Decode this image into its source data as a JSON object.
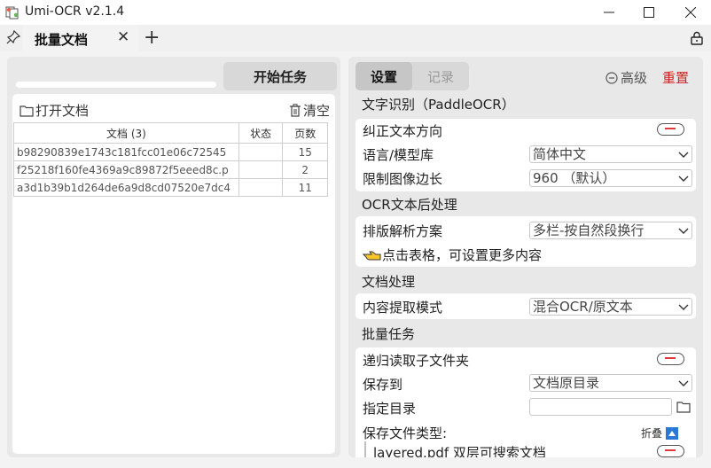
{
  "window": {
    "title": "Umi-OCR v2.1.4",
    "minimize_icon": "minimize-icon",
    "maximize_icon": "maximize-icon",
    "close_icon": "close-icon"
  },
  "tabbar": {
    "pin_icon": "pin-icon",
    "tabs": [
      {
        "label": "批量文档",
        "active": true
      }
    ],
    "add_icon": "plus-icon",
    "lock_icon": "lock-icon"
  },
  "left": {
    "progress": 0,
    "start_button": "开始任务",
    "open_button": "打开文档",
    "clear_button": "清空",
    "table": {
      "headers": [
        "文档 (3)",
        "状态",
        "页数"
      ],
      "rows": [
        {
          "name": "b98290839e1743c181fcc01e06c72545",
          "status": "",
          "pages": "15"
        },
        {
          "name": "f25218f160fe4369a9c89872f5eeed8c.p",
          "status": "",
          "pages": "2"
        },
        {
          "name": "a3d1b39b1d264de6a9d8cd07520e7dc4",
          "status": "",
          "pages": "11"
        }
      ]
    }
  },
  "right": {
    "tabs": {
      "settings": "设置",
      "records": "记录"
    },
    "advanced": "高级",
    "reset": "重置",
    "sections": {
      "ocr": "文字识别（PaddleOCR）",
      "post": "OCR文本后处理",
      "doc": "文档处理",
      "batch": "批量任务"
    },
    "ocr_rows": {
      "correct_direction": "纠正文本方向",
      "language": "语言/模型库",
      "language_value": "简体中文",
      "limit_side": "限制图像边长",
      "limit_side_value": "960 （默认）"
    },
    "post_rows": {
      "layout": "排版解析方案",
      "layout_value": "多栏-按自然段换行",
      "hint": "点击表格，可设置更多内容"
    },
    "doc_rows": {
      "extract_mode": "内容提取模式",
      "extract_mode_value": "混合OCR/原文本"
    },
    "batch_rows": {
      "recurse": "递归读取子文件夹",
      "save_to": "保存到",
      "save_to_value": "文档原目录",
      "target_dir": "指定目录",
      "target_dir_value": "",
      "file_types": "保存文件类型:",
      "collapse": "折叠",
      "layered_pdf": "layered.pdf 双层可搜索文档"
    },
    "colors": {
      "reset": "#d32020",
      "toggle_knob": "#e03b3b",
      "collapse_square": "#2a78d6"
    }
  }
}
